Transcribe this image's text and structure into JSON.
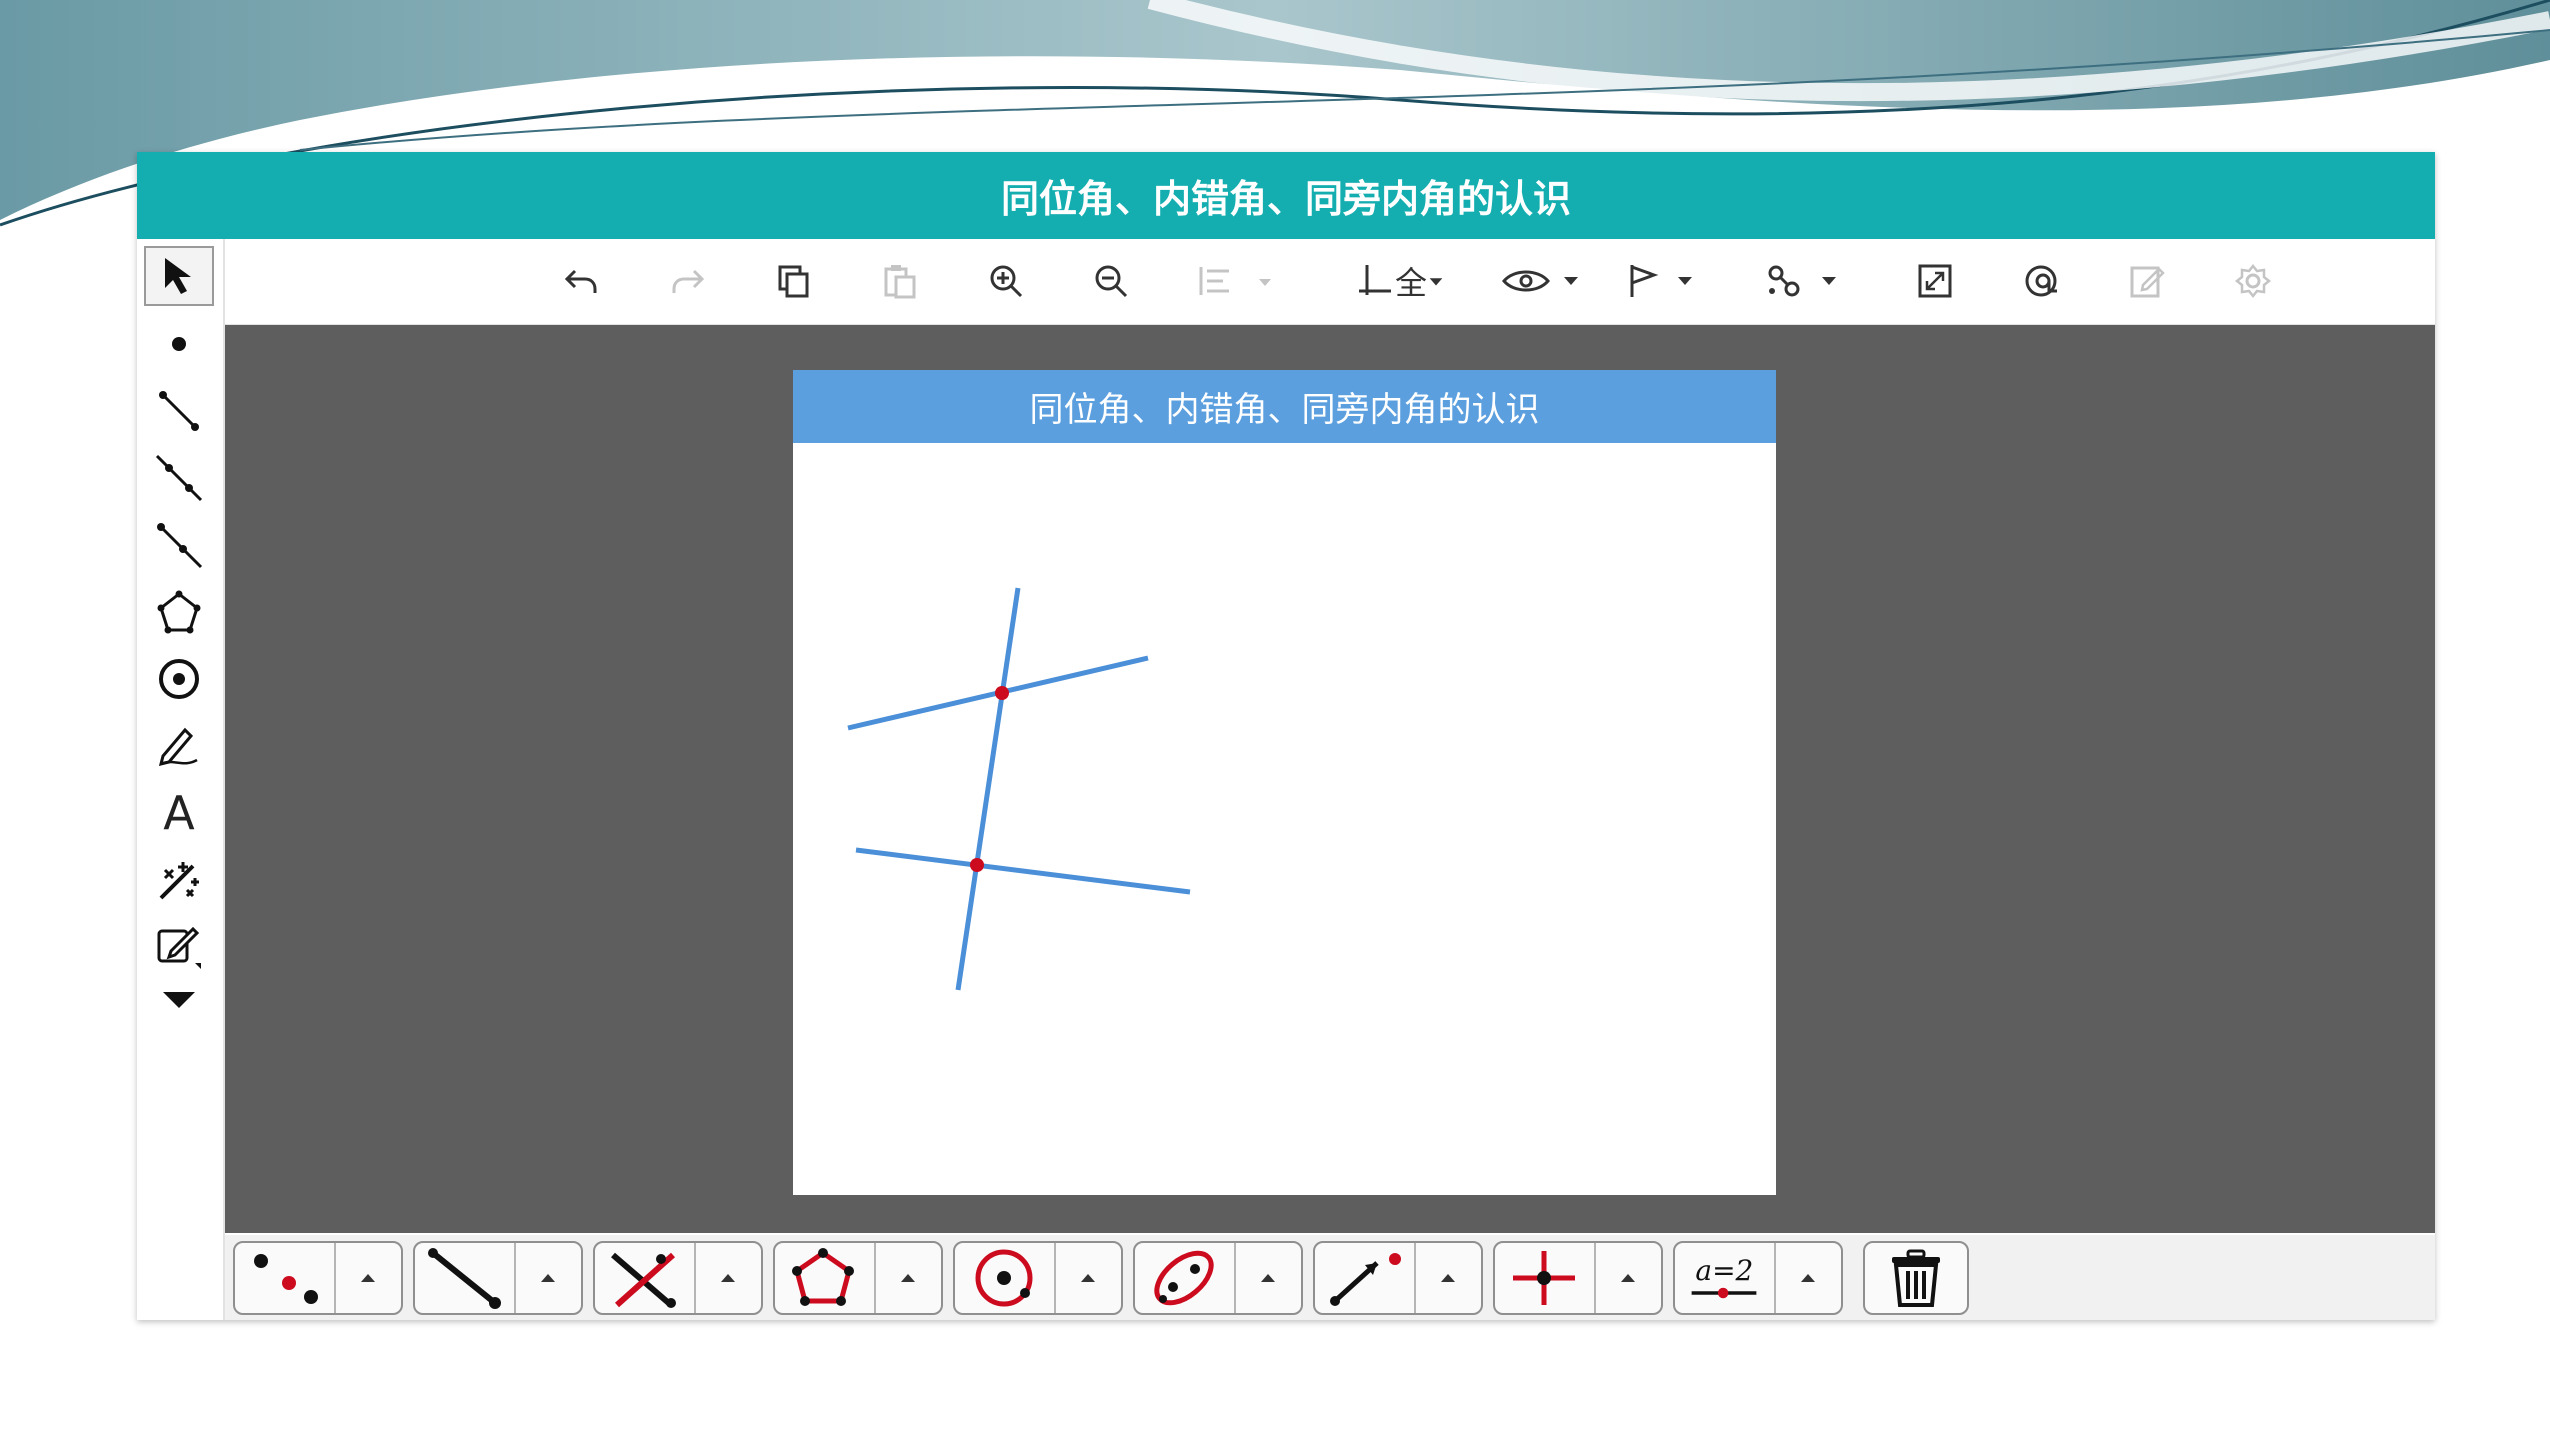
{
  "window": {
    "title": "同位角、内错角、同旁内角的认识"
  },
  "document": {
    "title": "同位角、内错角、同旁内角的认识"
  },
  "top_toolbar": {
    "icons": [
      "undo-icon",
      "redo-icon",
      "copy-icon",
      "paste-icon",
      "zoom-in-icon",
      "zoom-out-icon",
      "align-icon",
      "axis-grid-icon",
      "visibility-icon",
      "flag-icon",
      "animation-icon",
      "fullscreen-icon",
      "link-icon",
      "edit-icon",
      "settings-icon"
    ],
    "axis_label": "全"
  },
  "left_toolbar": {
    "tools": [
      "pointer-tool",
      "point-tool",
      "segment-tool",
      "line-tool",
      "ray-tool",
      "polygon-tool",
      "circle-tool",
      "pen-tool",
      "text-tool",
      "transform-tool",
      "edit-tool",
      "more-tools"
    ],
    "text_tool_label": "A"
  },
  "bottom_toolbar": {
    "groups": [
      "points-group",
      "segment-group",
      "intersection-group",
      "polygon-group",
      "circle-group",
      "conic-group",
      "vector-group",
      "transform-group",
      "parameter-group"
    ],
    "parameter_label": "a=2",
    "delete": "trash-icon"
  },
  "colors": {
    "title_bar": "#15aeb0",
    "doc_header": "#5b9fdf",
    "canvas_bg": "#5e5e5f",
    "line_color": "#4a8fd8",
    "point_color": "#cc0b1f"
  }
}
